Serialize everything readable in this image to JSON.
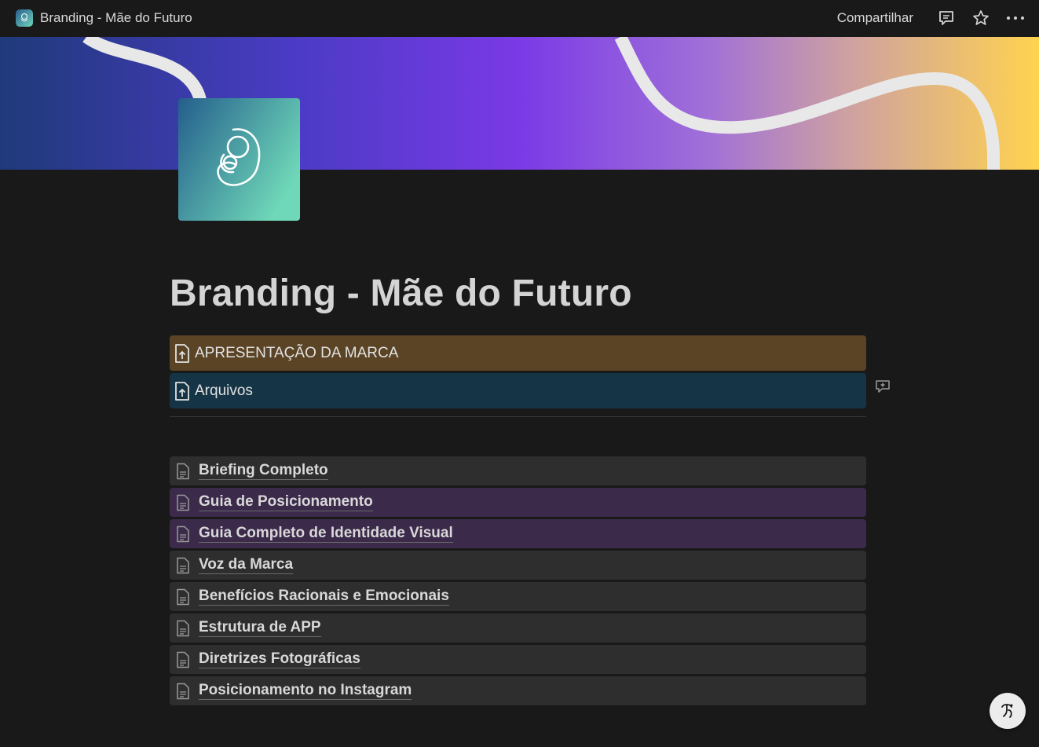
{
  "topbar": {
    "breadcrumb_title": "Branding - Mãe do Futuro",
    "share_label": "Compartilhar"
  },
  "page": {
    "title": "Branding - Mãe do Futuro"
  },
  "files": [
    {
      "label": "APRESENTAÇÃO DA MARCA",
      "color": "#5b4426"
    },
    {
      "label": "Arquivos",
      "color": "#153446"
    }
  ],
  "subpages": [
    {
      "label": "Briefing Completo",
      "color": "#2e2e2e"
    },
    {
      "label": "Guia de Posicionamento",
      "color": "#3b2a4a"
    },
    {
      "label": "Guia Completo de Identidade Visual",
      "color": "#3b2a4a"
    },
    {
      "label": "Voz da Marca",
      "color": "#2e2e2e"
    },
    {
      "label": "Benefícios Racionais e Emocionais",
      "color": "#2e2e2e"
    },
    {
      "label": "Estrutura de APP",
      "color": "#2e2e2e"
    },
    {
      "label": "Diretrizes Fotográficas",
      "color": "#2e2e2e"
    },
    {
      "label": "Posicionamento no Instagram",
      "color": "#2e2e2e"
    }
  ],
  "colors": {
    "background": "#191919",
    "cover_gradient": [
      "#1f3a7a",
      "#7a3ae6",
      "#ffd34f"
    ]
  },
  "icons": [
    "mother-child-logo-icon",
    "comment-icon",
    "star-icon",
    "more-icon",
    "file-upload-icon",
    "page-icon",
    "add-comment-icon",
    "help-icon"
  ]
}
